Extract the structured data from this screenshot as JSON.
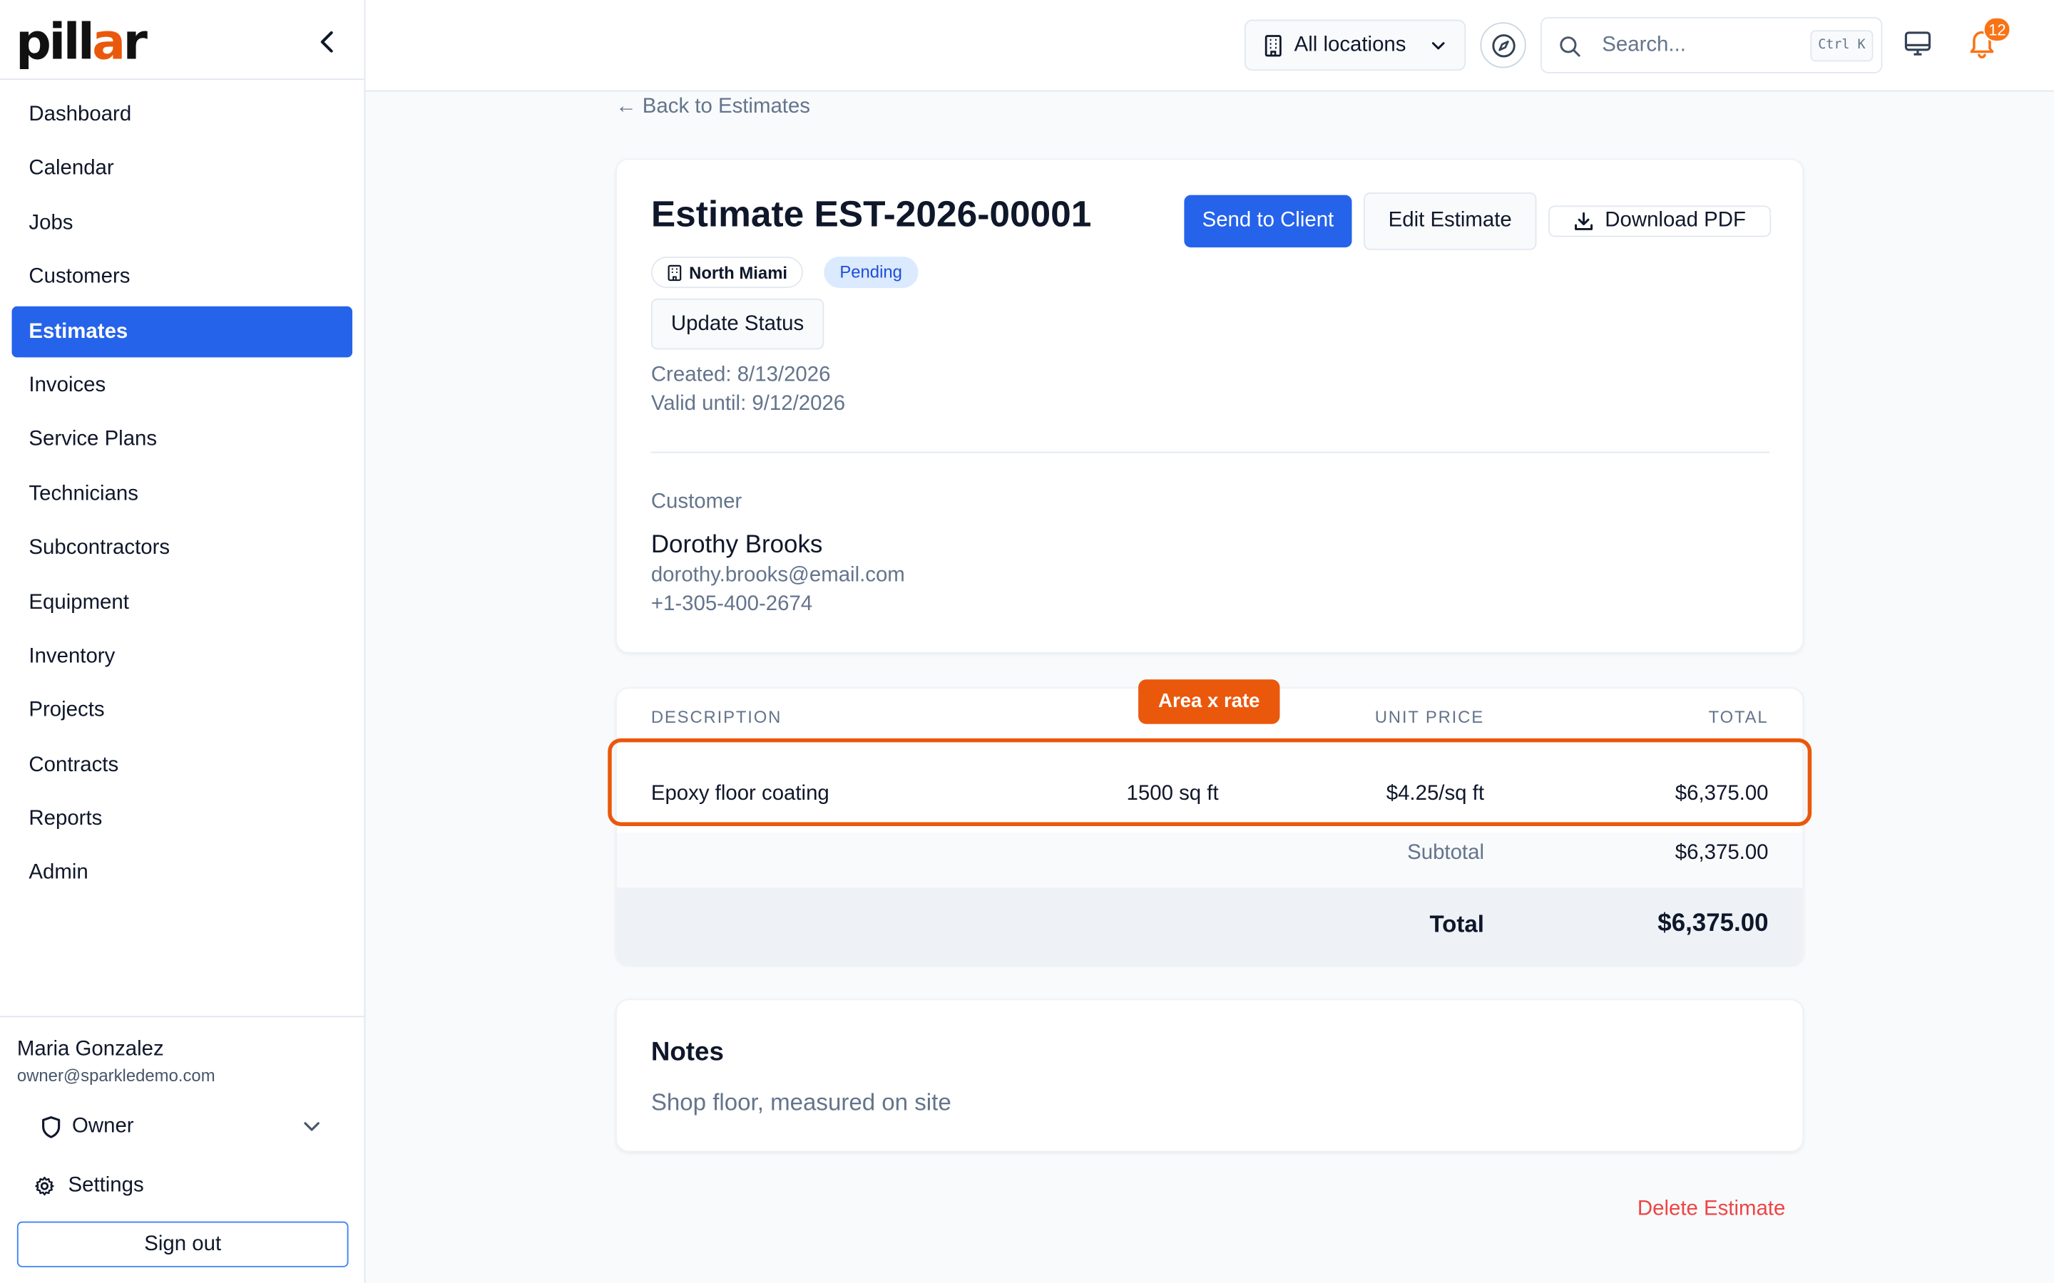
{
  "app": {
    "logo_text_pre": "pill",
    "logo_text_accent": "a",
    "logo_text_post": "r",
    "accent_color": "#2563eb",
    "brand_color": "#ea580c"
  },
  "sidebar": {
    "items": [
      {
        "label": "Dashboard"
      },
      {
        "label": "Calendar"
      },
      {
        "label": "Jobs"
      },
      {
        "label": "Customers"
      },
      {
        "label": "Estimates",
        "active": true
      },
      {
        "label": "Invoices"
      },
      {
        "label": "Service Plans"
      },
      {
        "label": "Technicians"
      },
      {
        "label": "Subcontractors"
      },
      {
        "label": "Equipment"
      },
      {
        "label": "Inventory"
      },
      {
        "label": "Projects"
      },
      {
        "label": "Contracts"
      },
      {
        "label": "Reports"
      },
      {
        "label": "Admin"
      }
    ],
    "user": {
      "name": "Maria Gonzalez",
      "email": "owner@sparkledemo.com",
      "role": "Owner"
    },
    "settings_label": "Settings",
    "signout_label": "Sign out"
  },
  "topbar": {
    "location_select": "All locations",
    "search_placeholder": "Search...",
    "search_shortcut": "Ctrl K",
    "notification_count": "12"
  },
  "estimate": {
    "back_label": "← Back to Estimates",
    "title": "Estimate EST-2026-00001",
    "send_label": "Send to Client",
    "edit_label": "Edit Estimate",
    "pdf_label": "Download PDF",
    "location": "North Miami",
    "status": "Pending",
    "update_status_label": "Update Status",
    "created": "Created: 8/13/2026",
    "valid_until": "Valid until: 9/12/2026",
    "customer": {
      "label": "Customer",
      "name": "Dorothy Brooks",
      "email": "dorothy.brooks@email.com",
      "phone": "+1-305-400-2674"
    }
  },
  "line_items": {
    "headers": {
      "description": "DESCRIPTION",
      "unit_price": "UNIT PRICE",
      "total": "TOTAL"
    },
    "rows": [
      {
        "description": "Epoxy floor coating",
        "quantity": "1500 sq ft",
        "unit_price": "$4.25/sq ft",
        "total": "$6,375.00"
      }
    ],
    "highlight_tag": "Area x rate",
    "subtotal_label": "Subtotal",
    "subtotal_value": "$6,375.00",
    "total_label": "Total",
    "total_value": "$6,375.00"
  },
  "notes": {
    "title": "Notes",
    "body": "Shop floor, measured on site"
  },
  "delete_label": "Delete Estimate"
}
